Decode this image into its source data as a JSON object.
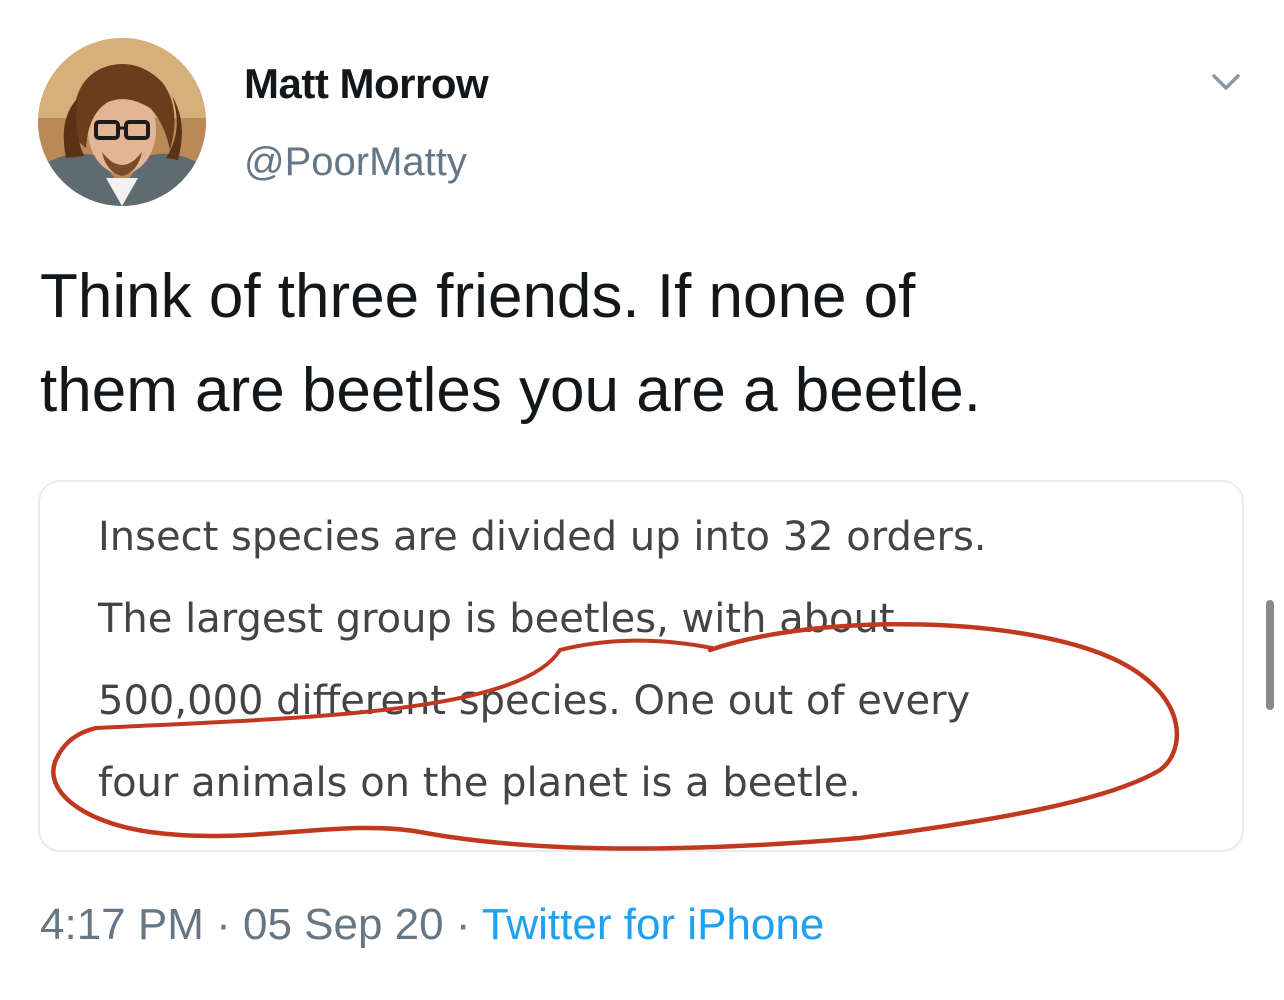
{
  "author": {
    "display_name": "Matt Morrow",
    "handle": "@PoorMatty"
  },
  "tweet": {
    "text_lines": [
      "Think of three friends.  If none of",
      "them are beetles you are a beetle."
    ]
  },
  "quoted_card": {
    "lines": [
      "Insect species are divided up into 32 orders.",
      "The largest group is beetles, with about",
      "500,000 different species. One out of every",
      "four animals on the planet is a beetle."
    ],
    "annotation_color": "#c0391f"
  },
  "meta": {
    "time": "4:17 PM",
    "separator": " · ",
    "date": "05 Sep 20",
    "source": "Twitter for iPhone"
  },
  "icons": {
    "menu": "chevron-down-icon"
  },
  "colors": {
    "text_primary": "#14171a",
    "text_secondary": "#657786",
    "link": "#1da1f2",
    "card_border": "#e6ecf0"
  }
}
